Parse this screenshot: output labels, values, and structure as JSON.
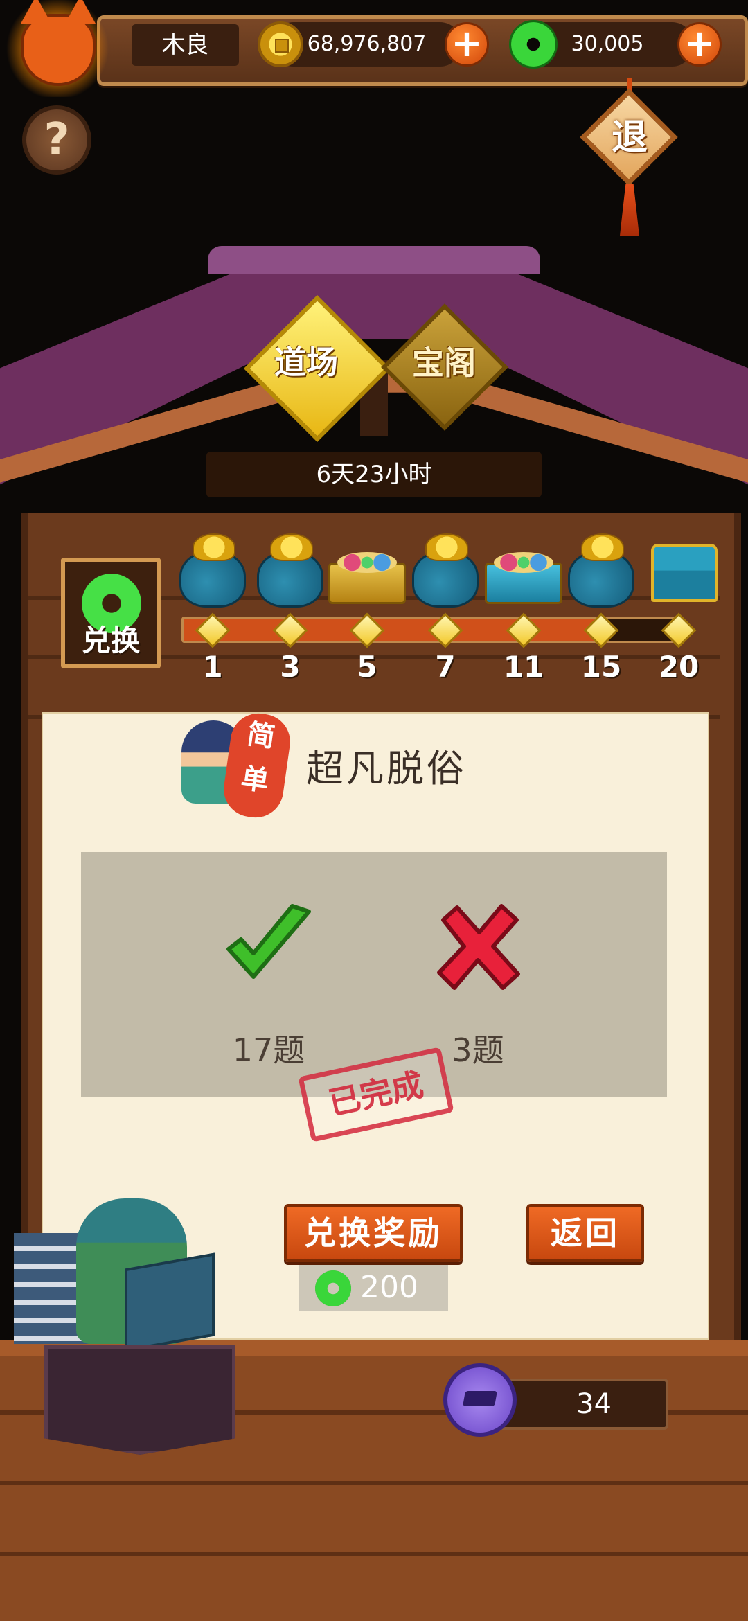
{
  "header": {
    "player_name": "木良",
    "coins": "68,976,807",
    "jade": "30,005",
    "help_label": "?",
    "exit_label": "退"
  },
  "tabs": [
    {
      "label": "道场",
      "active": true
    },
    {
      "label": "宝阁",
      "active": false
    }
  ],
  "timer": "6天23小时",
  "progress": {
    "exchange_label": "兑换",
    "current": 17,
    "max": 20,
    "milestones": [
      "1",
      "3",
      "5",
      "7",
      "11",
      "15",
      "20"
    ],
    "rewards": [
      "coin-bag-icon",
      "coin-bag-icon",
      "gem-tray-icon",
      "coin-bag-icon",
      "gem-chest-icon",
      "coin-bag-icon",
      "treasure-chest-icon"
    ]
  },
  "quiz": {
    "difficulty_1": "简",
    "difficulty_2": "单",
    "title": "超凡脱俗",
    "correct_count": "17题",
    "wrong_count": "3题",
    "stamp": "已完成"
  },
  "actions": {
    "redeem_label": "兑换奖励",
    "back_label": "返回",
    "redeem_cost": "200"
  },
  "footer": {
    "level_value": "34"
  },
  "colors": {
    "accent_orange": "#d8541a",
    "jade_green": "#3ad63a",
    "panel_bg": "#f9f0da",
    "stamp_red": "#d2283c"
  }
}
